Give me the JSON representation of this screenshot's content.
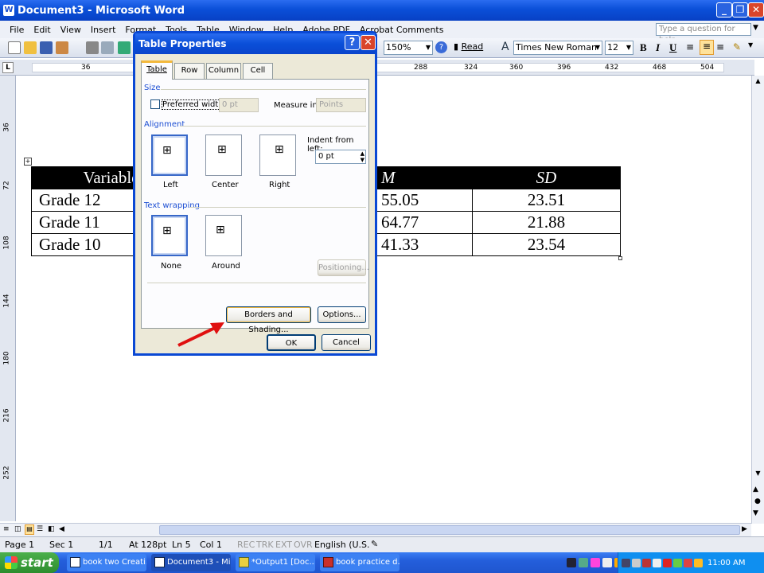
{
  "window": {
    "title": "Document3 - Microsoft Word",
    "help_placeholder": "Type a question for help"
  },
  "menu": [
    "File",
    "Edit",
    "View",
    "Insert",
    "Format",
    "Tools",
    "Table",
    "Window",
    "Help",
    "Adobe PDF",
    "Acrobat Comments"
  ],
  "toolbar": {
    "zoom": "150%",
    "read_label": "Read",
    "font": "Times New Roman",
    "size": "12"
  },
  "ruler": {
    "h_marks": [
      "36",
      "72",
      "288",
      "324",
      "360",
      "396",
      "432",
      "468",
      "504"
    ],
    "v_marks": [
      "36",
      "72",
      "108",
      "144",
      "180",
      "216",
      "252"
    ]
  },
  "doc_table": {
    "headers": [
      "Variable",
      "M",
      "SD"
    ],
    "rows": [
      {
        "variable": "Grade 12",
        "m": "55.05",
        "sd": "23.51"
      },
      {
        "variable": "Grade 11",
        "m": "64.77",
        "sd": "21.88"
      },
      {
        "variable": "Grade 10",
        "m": "41.33",
        "sd": "23.54"
      }
    ]
  },
  "dialog": {
    "title": "Table Properties",
    "tabs": [
      "Table",
      "Row",
      "Column",
      "Cell"
    ],
    "size_group": "Size",
    "preferred_width_label": "Preferred width:",
    "preferred_width_value": "0 pt",
    "measure_in_label": "Measure in:",
    "measure_in_value": "Points",
    "alignment_group": "Alignment",
    "align_left": "Left",
    "align_center": "Center",
    "align_right": "Right",
    "indent_label": "Indent from left:",
    "indent_value": "0 pt",
    "wrap_group": "Text wrapping",
    "wrap_none": "None",
    "wrap_around": "Around",
    "positioning_label": "Positioning...",
    "borders_label": "Borders and Shading...",
    "options_label": "Options...",
    "ok_label": "OK",
    "cancel_label": "Cancel"
  },
  "status": {
    "page": "Page 1",
    "sec": "Sec 1",
    "pages": "1/1",
    "at": "At 128pt",
    "ln": "Ln 5",
    "col": "Col 1",
    "rec": "REC",
    "trk": "TRK",
    "ext": "EXT",
    "ovr": "OVR",
    "lang": "English (U.S."
  },
  "taskbar": {
    "start": "start",
    "items": [
      "book two Creati...",
      "Document3 - Mi...",
      "*Output1 [Doc...",
      "book practice d..."
    ],
    "clock": "11:00 AM"
  },
  "colors": {
    "xp_blue": "#0a4fd8",
    "arrow_red": "#e01010",
    "group_label": "#1c4ed3"
  }
}
